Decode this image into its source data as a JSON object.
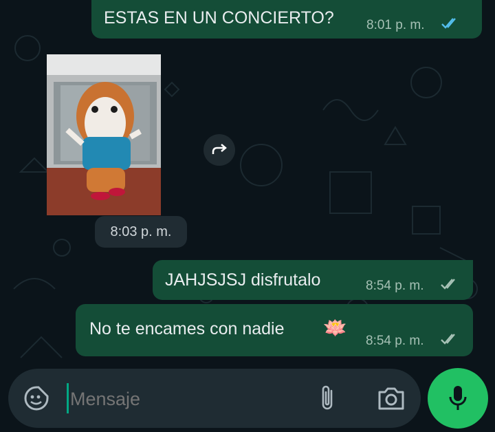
{
  "messages": [
    {
      "text": "ESTAS EN UN CONCIERTO?",
      "time": "8:01 p. m.",
      "status": "read"
    },
    {
      "time": "8:03 p. m."
    },
    {
      "text": "JAHJSJSJ disfrutalo",
      "time": "8:54 p. m.",
      "status": "delivered"
    },
    {
      "text": "No te encames con nadie",
      "emoji": "🪷",
      "time": "8:54 p. m.",
      "status": "delivered"
    }
  ],
  "composer": {
    "placeholder": "Mensaje"
  },
  "icons": {
    "emoji": "sticker-icon",
    "attach": "paperclip-icon",
    "camera": "camera-icon",
    "mic": "microphone-icon",
    "forward": "forward-icon"
  },
  "colors": {
    "outgoing_bubble": "#144d37",
    "incoming_bubble": "#202c33",
    "read_ticks": "#53bdeb",
    "mic_button": "#21c063"
  }
}
